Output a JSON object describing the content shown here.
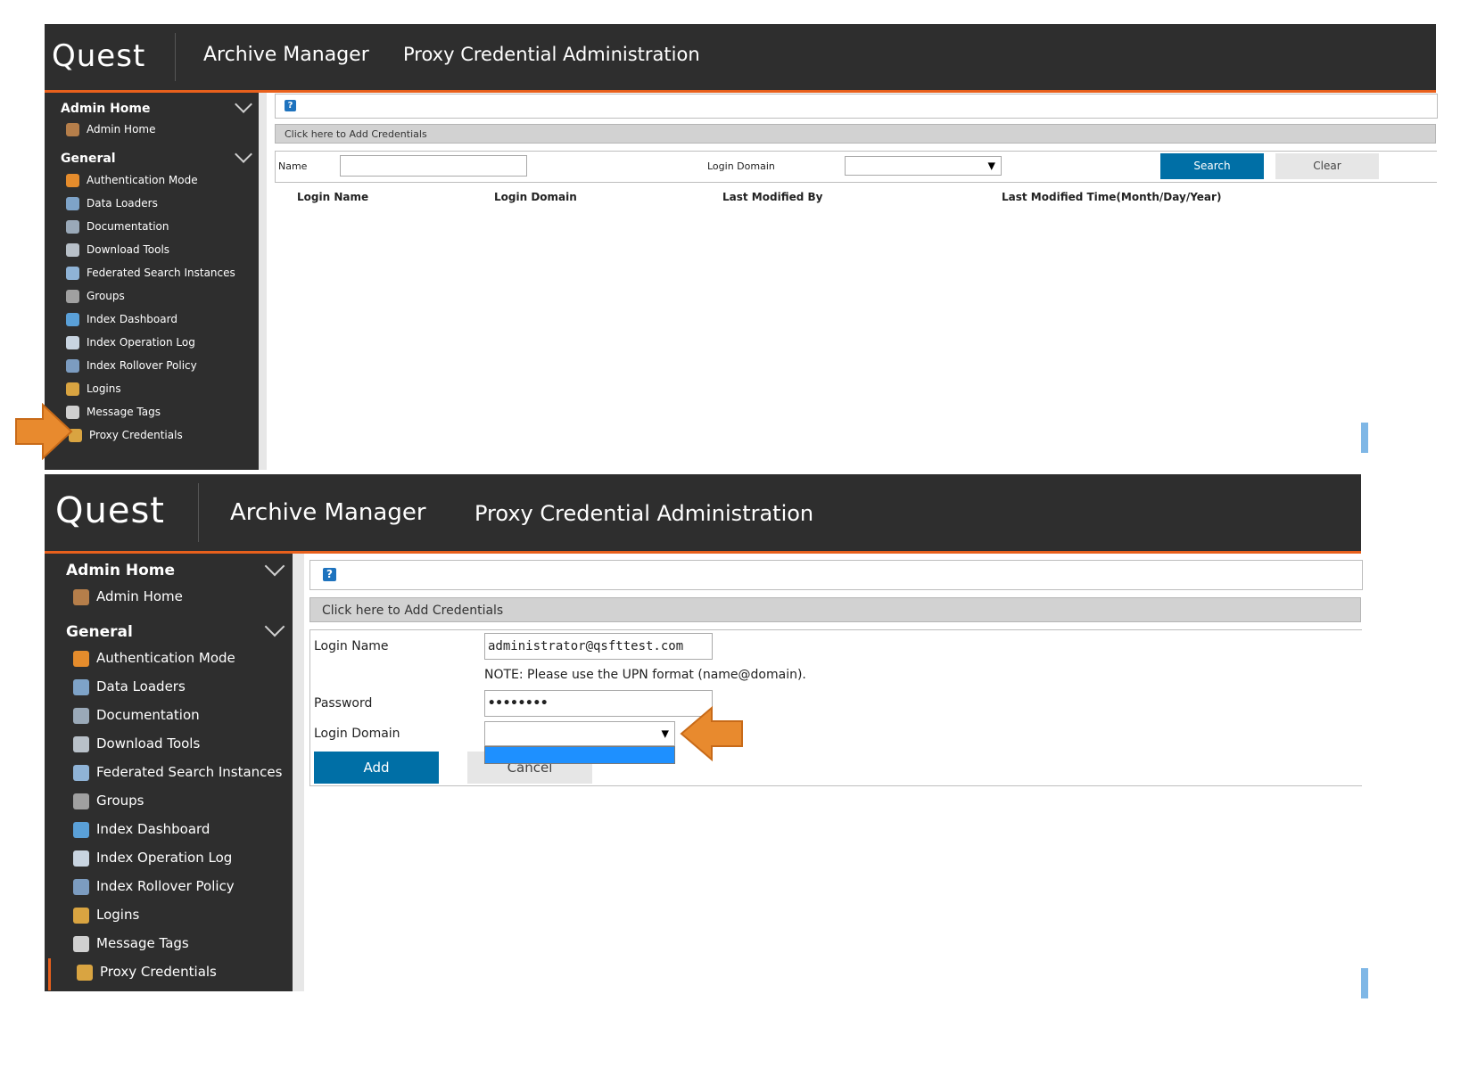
{
  "brand": "Quest",
  "app_title": "Archive Manager",
  "page_title": "Proxy Credential Administration",
  "sidebar": {
    "admin_section": "Admin Home",
    "admin_items": [
      {
        "label": "Admin Home",
        "icon": "user-icon"
      }
    ],
    "general_section": "General",
    "general_items": [
      {
        "label": "Authentication Mode",
        "icon": "auth-user-icon"
      },
      {
        "label": "Data Loaders",
        "icon": "data-loader-icon"
      },
      {
        "label": "Documentation",
        "icon": "documentation-icon"
      },
      {
        "label": "Download Tools",
        "icon": "download-icon"
      },
      {
        "label": "Federated Search Instances",
        "icon": "federated-search-icon"
      },
      {
        "label": "Groups",
        "icon": "groups-icon"
      },
      {
        "label": "Index Dashboard",
        "icon": "index-dashboard-icon"
      },
      {
        "label": "Index Operation Log",
        "icon": "log-icon"
      },
      {
        "label": "Index Rollover Policy",
        "icon": "rollover-icon"
      },
      {
        "label": "Logins",
        "icon": "keys-icon"
      },
      {
        "label": "Message Tags",
        "icon": "tag-icon"
      },
      {
        "label": "Proxy Credentials",
        "icon": "keys-icon"
      }
    ]
  },
  "help_icon_label": "?",
  "add_credentials_label": "Click here to Add Credentials",
  "search_panel": {
    "name_label": "Name",
    "name_value": "",
    "login_domain_label": "Login Domain",
    "login_domain_value": "",
    "search_button": "Search",
    "clear_button": "Clear",
    "columns": [
      "Login Name",
      "Login Domain",
      "Last Modified By",
      "Last Modified Time(Month/Day/Year)"
    ]
  },
  "add_form": {
    "login_name_label": "Login Name",
    "login_name_value": "administrator@qsfttest.com",
    "note": "NOTE: Please use the UPN format (name@domain).",
    "password_label": "Password",
    "password_value": "••••••••",
    "login_domain_label": "Login Domain",
    "login_domain_value": "",
    "add_button": "Add",
    "cancel_button": "Cancel"
  },
  "colors": {
    "header_bg": "#2e2e2e",
    "accent": "#e8601c",
    "primary_button": "#006fa6",
    "dropdown_highlight": "#1e90ff"
  }
}
